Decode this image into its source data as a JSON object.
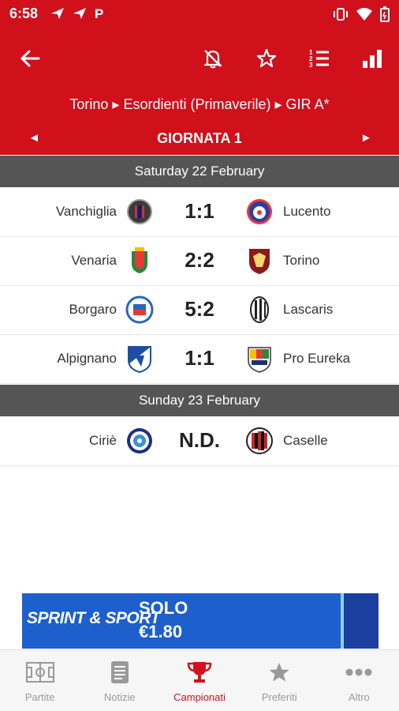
{
  "status_bar": {
    "time": "6:58",
    "icons": [
      "send-icon",
      "send-icon",
      "p-icon"
    ],
    "right_icons": [
      "vibrate-icon",
      "wifi-icon",
      "battery-icon"
    ]
  },
  "toolbar": {
    "back_icon": "arrow-left-icon",
    "actions": [
      "notifications-off-icon",
      "star-outline-icon",
      "ranking-list-icon",
      "bar-chart-icon"
    ],
    "breadcrumb": "Torino ▸ Esordienti (Primaverile) ▸ GIR A*",
    "round_title": "GIORNATA 1",
    "prev_arrow": "◄",
    "next_arrow": "►"
  },
  "days": [
    {
      "label": "Saturday 22 February",
      "matches": [
        {
          "home": "Vanchiglia",
          "score": "1:1",
          "away": "Lucento"
        },
        {
          "home": "Venaria",
          "score": "2:2",
          "away": "Torino"
        },
        {
          "home": "Borgaro",
          "score": "5:2",
          "away": "Lascaris"
        },
        {
          "home": "Alpignano",
          "score": "1:1",
          "away": "Pro Eureka"
        }
      ]
    },
    {
      "label": "Sunday 23 February",
      "matches": [
        {
          "home": "Ciriè",
          "score": "N.D.",
          "away": "Caselle"
        }
      ]
    }
  ],
  "ad": {
    "brand": "SPRINT & SPORT",
    "line1": "SOLO",
    "line2": "€1.80"
  },
  "bottom_nav": [
    {
      "label": "Partite",
      "icon": "field-icon",
      "active": false
    },
    {
      "label": "Notizie",
      "icon": "news-icon",
      "active": false
    },
    {
      "label": "Campionati",
      "icon": "trophy-icon",
      "active": true
    },
    {
      "label": "Preferiti",
      "icon": "star-icon",
      "active": false
    },
    {
      "label": "Altro",
      "icon": "more-icon",
      "active": false
    }
  ],
  "colors": {
    "primary": "#d0101b",
    "day_header": "#555555",
    "nav_inactive": "#9a9a9a"
  }
}
